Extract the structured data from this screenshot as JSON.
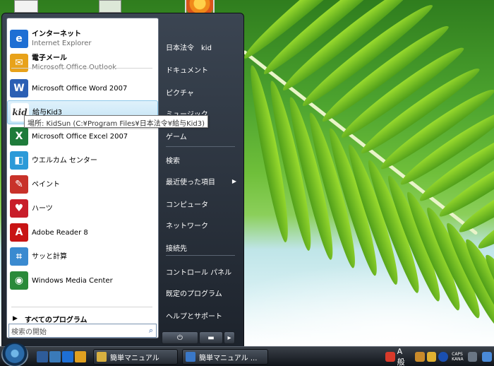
{
  "left_items": [
    {
      "title": "インターネット",
      "sub": "Internet Explorer",
      "icon": "internet-explorer-icon",
      "color": "#1e6fd4",
      "glyph": "e"
    },
    {
      "title": "電子メール",
      "sub": "Microsoft Office Outlook",
      "icon": "outlook-icon",
      "color": "#e8a21a",
      "glyph": "✉"
    },
    {
      "title": "Microsoft Office Word 2007",
      "sub": "",
      "icon": "word-icon",
      "color": "#2b5fb4",
      "glyph": "W"
    },
    {
      "title": "給与Kid3",
      "sub": "",
      "icon": "kyuyo-kid-icon",
      "color": "#ffffff",
      "glyph": "kid"
    },
    {
      "title": "Microsoft Office Excel 2007",
      "sub": "",
      "icon": "excel-icon",
      "color": "#1e7b3a",
      "glyph": "X"
    },
    {
      "title": "ウエルカム センター",
      "sub": "",
      "icon": "welcome-center-icon",
      "color": "#2b9ad8",
      "glyph": "◧"
    },
    {
      "title": "ペイント",
      "sub": "",
      "icon": "paint-icon",
      "color": "#c8322a",
      "glyph": "✎"
    },
    {
      "title": "ハーツ",
      "sub": "",
      "icon": "hearts-icon",
      "color": "#c81e2a",
      "glyph": "♥"
    },
    {
      "title": "Adobe Reader 8",
      "sub": "",
      "icon": "adobe-reader-icon",
      "color": "#c81414",
      "glyph": "A"
    },
    {
      "title": "サッと計算",
      "sub": "",
      "icon": "calculator-icon",
      "color": "#3a8ad0",
      "glyph": "⌗"
    },
    {
      "title": "Windows Media Center",
      "sub": "",
      "icon": "media-center-icon",
      "color": "#2a8a3a",
      "glyph": "◉"
    }
  ],
  "tooltip": "場所: KidSun (C:¥Program Files¥日本法令¥給与Kid3)",
  "all_programs": "すべてのプログラム",
  "search_placeholder": "検索の開始",
  "right_items": [
    "日本法令　kid",
    "ドキュメント",
    "ピクチャ",
    "ミュージック",
    "ゲーム",
    "検索",
    "最近使った項目",
    "コンピュータ",
    "ネットワーク",
    "接続先",
    "コントロール パネル",
    "既定のプログラム",
    "ヘルプとサポート"
  ],
  "taskbar": {
    "tasks": [
      "簡単マニュアル",
      "簡単マニュアル ..."
    ],
    "tray_ime": "A 般",
    "tray_caps": "CAPS",
    "tray_kana": "KANA"
  },
  "colors": {
    "accent": "#c3e4f6",
    "menu_dark": "#1d232c"
  }
}
